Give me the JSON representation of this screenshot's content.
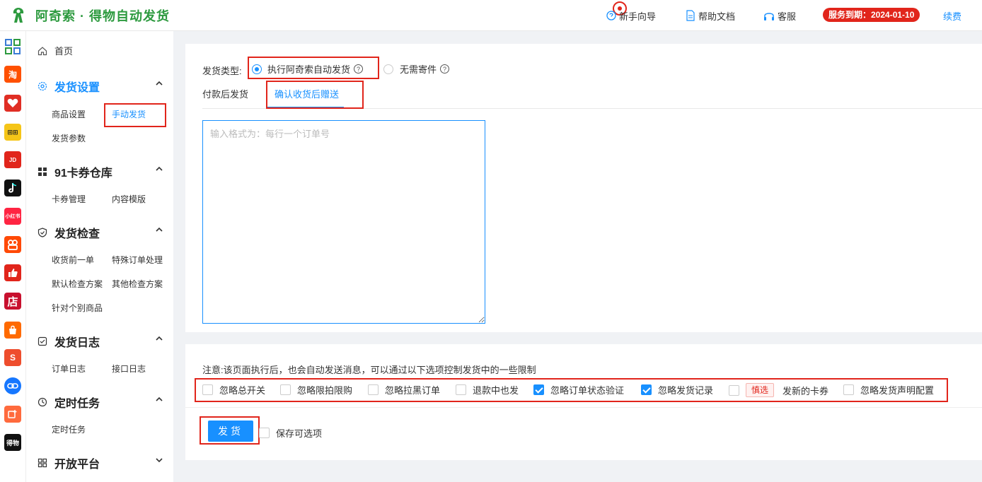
{
  "header": {
    "app_title": "阿奇索 · 得物自动发货",
    "guide": "新手向导",
    "help_docs": "帮助文档",
    "service": "客服",
    "expiry": "服务到期：2024-01-10",
    "renew": "续费"
  },
  "rail": {
    "icons": [
      {
        "name": "apps-grid-icon",
        "label": "",
        "color": "#3a7bd5"
      },
      {
        "name": "taobao-icon",
        "label": "淘",
        "color": "#ff5000"
      },
      {
        "name": "pinduoduo-icon",
        "label": "",
        "color": "#e02e24"
      },
      {
        "name": "yinzan-icon",
        "label": "",
        "color": "#f5c518"
      },
      {
        "name": "jd-icon",
        "label": "",
        "color": "#e1251b"
      },
      {
        "name": "douyin-icon",
        "label": "",
        "color": "#111111"
      },
      {
        "name": "xiaohongshu-icon",
        "label": "小红书",
        "color": "#ff2442"
      },
      {
        "name": "kuaishou-icon",
        "label": "",
        "color": "#ff4906"
      },
      {
        "name": "thumbs-up-icon",
        "label": "",
        "color": "#e1251b"
      },
      {
        "name": "store-icon",
        "label": "店",
        "color": "#c8102e"
      },
      {
        "name": "shopping-bag-icon",
        "label": "",
        "color": "#ff6a00"
      },
      {
        "name": "shopee-icon",
        "label": "S",
        "color": "#ee4d2d"
      },
      {
        "name": "link-icon",
        "label": "",
        "color": "#1677ff"
      },
      {
        "name": "card-plus-icon",
        "label": "",
        "color": "#ff6a3d"
      },
      {
        "name": "dewu-icon",
        "label": "得物",
        "color": "#111111"
      }
    ]
  },
  "sidebar": {
    "home": "首页",
    "groups": [
      {
        "title": "发货设置",
        "items": [
          "商品设置",
          "手动发货",
          "发货参数"
        ]
      },
      {
        "title": "91卡券仓库",
        "items": [
          "卡券管理",
          "内容模版"
        ]
      },
      {
        "title": "发货检查",
        "items": [
          "收货前一单",
          "特殊订单处理",
          "默认检查方案",
          "其他检查方案",
          "针对个别商品"
        ]
      },
      {
        "title": "发货日志",
        "items": [
          "订单日志",
          "接口日志"
        ]
      },
      {
        "title": "定时任务",
        "items": [
          "定时任务"
        ]
      },
      {
        "title": "开放平台",
        "items": []
      }
    ]
  },
  "form": {
    "type_label": "发货类型:",
    "type_options": [
      {
        "label": "执行阿奇索自动发货",
        "selected": true
      },
      {
        "label": "无需寄件",
        "selected": false
      }
    ],
    "tabs": [
      {
        "label": "付款后发货",
        "active": false
      },
      {
        "label": "确认收货后赠送",
        "active": true
      }
    ],
    "order_input_placeholder": "输入格式为：每行一个订单号",
    "notice": "注意:该页面执行后，也会自动发送消息，可以通过以下选项控制发货中的一些限制",
    "options": [
      {
        "label": "忽略总开关",
        "checked": false
      },
      {
        "label": "忽略限拍限购",
        "checked": false
      },
      {
        "label": "忽略拉黑订单",
        "checked": false
      },
      {
        "label": "退款中也发",
        "checked": false
      },
      {
        "label": "忽略订单状态验证",
        "checked": true
      },
      {
        "label": "忽略发货记录",
        "checked": true
      },
      {
        "label": "发新的卡券",
        "checked": false,
        "tag": "慎选"
      },
      {
        "label": "忽略发货声明配置",
        "checked": false
      }
    ],
    "send_button": "发货",
    "save_options": "保存可选项"
  },
  "colors": {
    "accent": "#1890ff",
    "brand_green": "#2d9a3f",
    "highlight_red": "#e1251b"
  }
}
